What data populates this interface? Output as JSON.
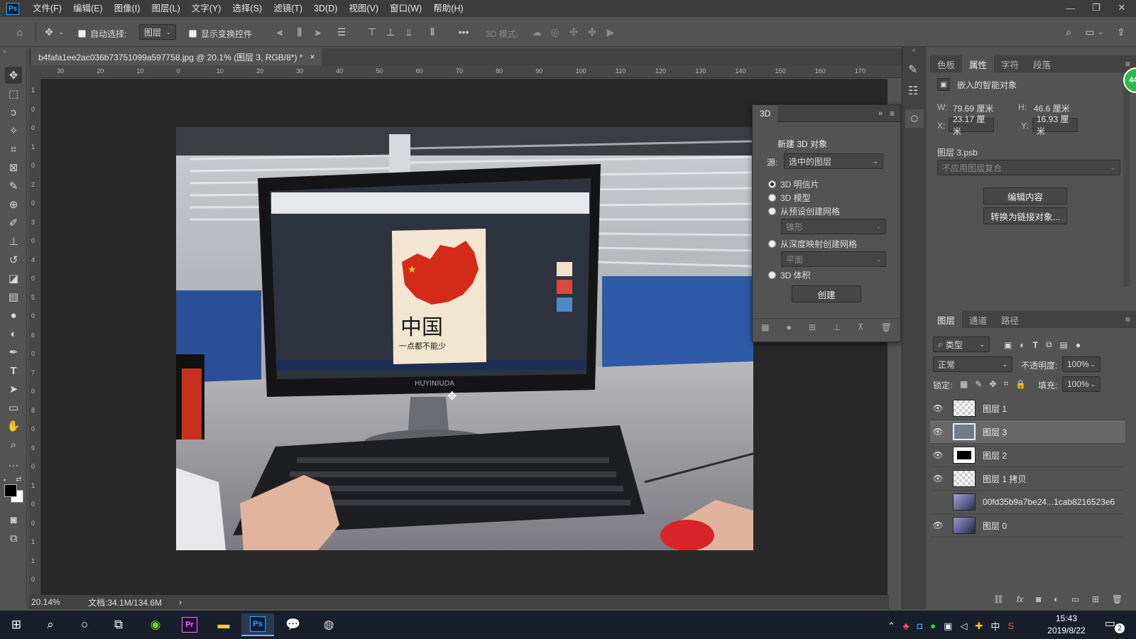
{
  "app": {
    "logo": "Ps",
    "accent": "#31a8ff"
  },
  "menu": [
    "文件(F)",
    "编辑(E)",
    "图像(I)",
    "图层(L)",
    "文字(Y)",
    "选择(S)",
    "滤镜(T)",
    "3D(D)",
    "视图(V)",
    "窗口(W)",
    "帮助(H)"
  ],
  "options": {
    "auto_select_label": "自动选择:",
    "auto_select_target": "图层",
    "show_transform_label": "显示变换控件",
    "mode_3d_label": "3D 模式:"
  },
  "document": {
    "tab_title": "b4fafa1ee2ac036b73751099a597758.jpg @ 20.1% (图层 3, RGB/8*) *",
    "close": "×",
    "zoom": "20.14%",
    "doc_info": "文档:34.1M/134.6M",
    "status_arrow": "›"
  },
  "ruler_top": [
    "30",
    "20",
    "10",
    "0",
    "10",
    "20",
    "30",
    "40",
    "50",
    "60",
    "70",
    "80",
    "90",
    "100",
    "110",
    "120",
    "130",
    "140",
    "150",
    "160",
    "170"
  ],
  "ruler_left": [
    "1",
    "0",
    "0",
    "1",
    "0",
    "2",
    "0",
    "3",
    "0",
    "4",
    "0",
    "5",
    "0",
    "6",
    "0",
    "7",
    "0",
    "8",
    "0",
    "9",
    "0",
    "1",
    "0",
    "0",
    "1",
    "1",
    "0"
  ],
  "photo": {
    "monitor_brand": "HUYINIUDA",
    "poster_title": "中国",
    "poster_subtitle": "一点都不能少"
  },
  "properties_panel": {
    "tabs": [
      "色板",
      "属性",
      "字符",
      "段落"
    ],
    "active_tab": "属性",
    "object_type": "嵌入的智能对象",
    "w_label": "W:",
    "w_value": "79.69 厘米",
    "h_label": "H:",
    "h_value": "46.6 厘米",
    "x_label": "X:",
    "x_value": "23.17 厘米",
    "y_label": "Y:",
    "y_value": "16.93 厘米",
    "file_name": "图层 3.psb",
    "comp_placeholder": "不应用图层复合",
    "edit_button": "编辑内容",
    "convert_button": "转换为链接对象..."
  },
  "threed_panel": {
    "title": "3D",
    "new_object_label": "新建 3D 对象",
    "source_label": "源:",
    "source_value": "选中的图层",
    "options": [
      "3D 明信片",
      "3D 模型",
      "从预设创建网格",
      "从深度映射创建网格",
      "3D 体积"
    ],
    "preset_value": "锥形",
    "depth_value": "平面",
    "create_button": "创建"
  },
  "layers_panel": {
    "tabs": [
      "图层",
      "通道",
      "路径"
    ],
    "active_tab": "图层",
    "filter_kind": "类型",
    "blend_mode": "正常",
    "opacity_label": "不透明度:",
    "opacity_value": "100%",
    "lock_label": "锁定:",
    "fill_label": "填充:",
    "fill_value": "100%",
    "fx_label": "fx",
    "layers": [
      {
        "name": "图层 1",
        "visible": true,
        "thumb": "transparent"
      },
      {
        "name": "图层 3",
        "visible": true,
        "thumb": "smart",
        "selected": true
      },
      {
        "name": "图层 2",
        "visible": true,
        "thumb": "black"
      },
      {
        "name": "图层 1 拷贝",
        "visible": true,
        "thumb": "transparent"
      },
      {
        "name": "00fd35b9a7be24...1cab8216523e6",
        "visible": false,
        "thumb": "photo"
      },
      {
        "name": "图层 0",
        "visible": true,
        "thumb": "photo"
      }
    ]
  },
  "taskbar": {
    "time": "15:43",
    "date": "2019/8/22",
    "ime": "中",
    "notification_count": "2",
    "apps": [
      "start-icon",
      "search-icon",
      "cortana-icon",
      "task-view-icon",
      "browser-icon",
      "premiere-icon",
      "explorer-icon",
      "photoshop-icon",
      "wechat-icon",
      "obs-icon"
    ]
  },
  "badge": {
    "value": "44",
    "color": "#2fb84a"
  }
}
